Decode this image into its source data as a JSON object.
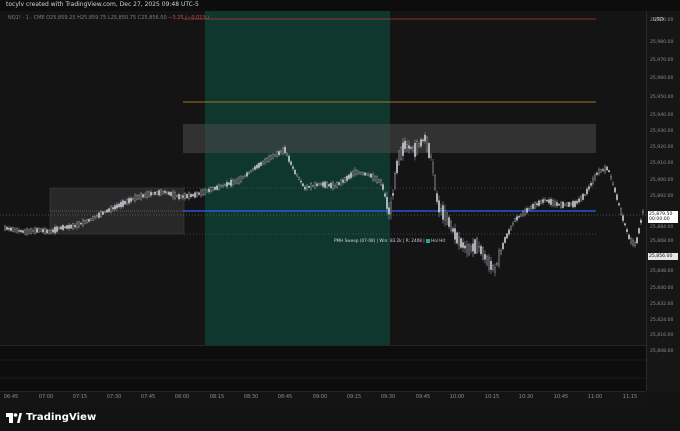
{
  "header": {
    "text": "tocylv created with TradingView.com, Dec 27, 2025 09:48 UTC-5"
  },
  "legend": {
    "symbol": "NQ1! · 1 · CME",
    "ohlc": "O25,859.25 H25,859.75 L25,850.75 C25,856.00",
    "change": "−3.25 (−0.01%)"
  },
  "price_axis": {
    "currency": "USD",
    "ticks": [
      "25,990.00",
      "25,980.00",
      "25,970.00",
      "25,960.00",
      "25,950.00",
      "25,940.00",
      "25,930.00",
      "25,920.00",
      "25,910.00",
      "25,900.00",
      "25,892.00",
      "25,884.00",
      "25,868.00",
      "25,848.00",
      "25,840.00",
      "25,832.00",
      "25,824.00",
      "25,816.00",
      "25,808.00"
    ],
    "current_price": "25,879.50",
    "current_sub": "00:00:00",
    "low_price": "25,856.00"
  },
  "time_axis": {
    "ticks": [
      "06:45",
      "07:00",
      "07:15",
      "07:30",
      "07:45",
      "08:00",
      "08:15",
      "08:30",
      "08:45",
      "09:00",
      "09:15",
      "09:30",
      "09:45",
      "10:00",
      "10:15",
      "10:30",
      "10:45",
      "11:00",
      "11:15"
    ]
  },
  "annotation": {
    "text": "PMH Sweep (07-08) | Win: 83.2k | R: 2408 |",
    "badge": "Hol Hit"
  },
  "footer": {
    "brand": "TradingView"
  },
  "colors": {
    "red_line": "#b23a3a",
    "orange_line": "#c7931f",
    "blue_line": "#2962ff",
    "green_zone": "#0f3d31",
    "candle": "#d1d4dc"
  }
}
